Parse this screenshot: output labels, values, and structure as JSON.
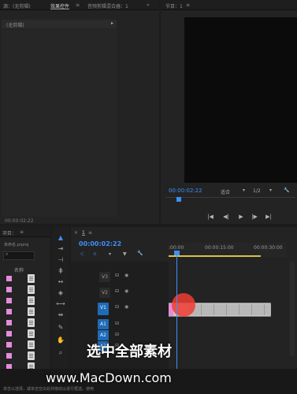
{
  "source_panel": {
    "tabs": [
      "源：(无剪辑)",
      "效果控件",
      "音频剪辑混合器：1"
    ],
    "clip_label": "(无剪辑)",
    "timecode": "00:00:02:22",
    "menu_icon": "panel-menu-icon"
  },
  "program_panel": {
    "tab": "节目：1",
    "timecode": "00:00:02:22",
    "fit_label": "适合",
    "resolution": "1/2",
    "controls": [
      "step-back-icon",
      "play-back-icon",
      "play-icon",
      "step-forward-icon",
      "loop-icon"
    ]
  },
  "project_panel": {
    "tab": "项目：",
    "project_name": "未命名.prproj",
    "column_header": "名称",
    "items_count": 10
  },
  "timeline": {
    "sequence_tab": "1",
    "timecode": "00:00:02:22",
    "ruler": [
      ":00:00",
      "00:00:15:00",
      "00:00:30:00"
    ],
    "video_tracks": [
      "V3",
      "V2",
      "V1"
    ],
    "audio_tracks": [
      "A1",
      "A2",
      "A3"
    ],
    "source_patch": [
      "V1",
      "A1"
    ]
  },
  "tools": [
    "selection-tool-icon",
    "track-select-icon",
    "ripple-edit-icon",
    "rolling-edit-icon",
    "rate-stretch-icon",
    "razor-icon",
    "slip-icon",
    "slide-icon",
    "pen-icon",
    "hand-icon",
    "zoom-icon"
  ],
  "overlay": {
    "caption": "选中全部素材",
    "watermark": "www.MacDown.com"
  },
  "status_bar": "单击以选择，或单击空白处并拖动以进行框选。使用"
}
